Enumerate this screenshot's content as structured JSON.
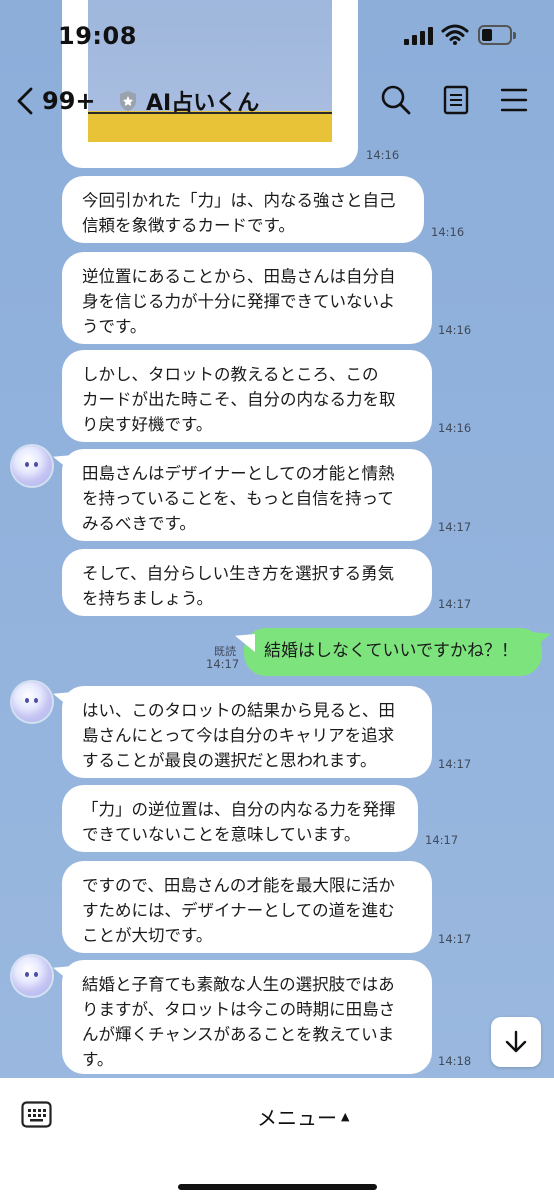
{
  "status_bar": {
    "time": "19:08",
    "battery_level": 0.3
  },
  "header": {
    "back_icon": "chevron-left-icon",
    "unread_count": "99+",
    "room_name": "AI占いくん",
    "icons": [
      "search-icon",
      "notes-icon",
      "menu-icon"
    ]
  },
  "image_card": {
    "time": "14:16"
  },
  "messages": [
    {
      "text": "今回引かれた「力」は、内なる強さと自己\n信頼を象徴するカードです。",
      "time": "14:16"
    },
    {
      "text": "逆位置にあることから、田島さんは自分自\n身を信じる力が十分に発揮できていないよ\nうです。",
      "time": "14:16"
    },
    {
      "text": " しかし、タロットの教えるところ、この\nカードが出た時こそ、自分の内なる力を取\nり戻す好機です。",
      "time": "14:16"
    },
    {
      "text": "田島さんはデザイナーとしての才能と情熱\nを持っていることを、もっと自信を持って\nみるべきです。",
      "time": "14:17"
    },
    {
      "text": "そして、自分らしい生き方を選択する勇気\nを持ちましょう。",
      "time": "14:17"
    },
    {
      "text": "結婚はしなくていいですかね？！",
      "time": "14:17",
      "read": "既読"
    },
    {
      "text": "はい、このタロットの結果から見ると、田\n島さんにとって今は自分のキャリアを追求\nすることが最良の選択だと思われます。",
      "time": "14:17"
    },
    {
      "text": "「力」の逆位置は、自分の内なる力を発揮\nできていないことを意味しています。",
      "time": "14:17"
    },
    {
      "text": "ですので、田島さんの才能を最大限に活か\nすためには、デザイナーとしての道を進む\nことが大切です。",
      "time": "14:17"
    },
    {
      "text": "結婚と子育ても素敵な人生の選択肢ではあ\nりますが、タロットは今この時期に田島さ\nんが輝くチャンスがあることを教えていま\nす。",
      "time": "14:18"
    }
  ],
  "bottom_bar": {
    "menu_label": "メニュー",
    "menu_arrow": "▲",
    "keyboard_icon": "keyboard-icon"
  },
  "colors": {
    "chat_bg": "#8fb0dc",
    "my_bubble": "#7de37c",
    "their_bubble": "#ffffff"
  }
}
